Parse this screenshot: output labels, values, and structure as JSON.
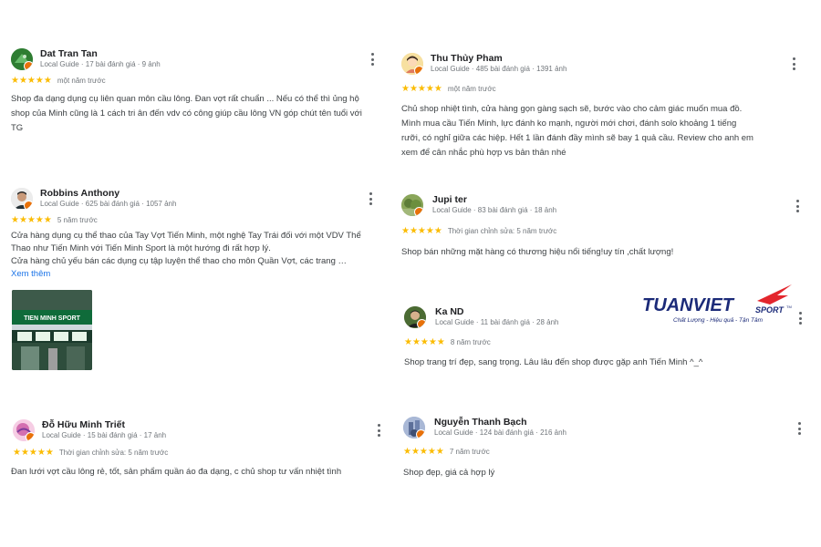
{
  "reviews": [
    {
      "name": "Dat Tran Tan",
      "meta": "Local Guide · 17 bài đánh giá · 9 ảnh",
      "stars": "★★★★★",
      "time": "một năm trước",
      "lines": [
        "Shop đa dạng dụng cụ liên quan môn cầu lông. Đan vợt rất chuẩn ... Nếu có thể thì ủng hộ",
        "shop của Minh cũng là 1 cách tri ân đến vdv có công giúp cầu lông VN góp chút tên tuổi với",
        "TG"
      ]
    },
    {
      "name": "Thu Thủy Pham",
      "meta": "Local Guide · 485 bài đánh giá · 1391 ảnh",
      "stars": "★★★★★",
      "time": "một năm trước",
      "lines": [
        "Chủ shop nhiệt tình, cửa hàng gọn gàng sạch sẽ, bước vào cho cảm giác muốn mua đồ.",
        "Mình mua cầu Tiến Minh, lực đánh ko mạnh, người mới chơi, đánh solo khoảng 1 tiếng",
        "rưỡi, có nghỉ giữa các hiệp. Hết 1 lần đánh đầy mình sẽ bay 1 quả cầu. Review cho anh em",
        "xem để cân nhắc phù hợp vs bản thân nhé"
      ]
    },
    {
      "name": "Robbins Anthony",
      "meta": "Local Guide · 625 bài đánh giá · 1057 ảnh",
      "stars": "★★★★★",
      "time": "5 năm trước",
      "lines": [
        "Cửa hàng dụng cụ thể thao của Tay Vợt Tiến Minh, một nghệ Tay Trái đối với một VDV Thể",
        "Thao như Tiến Minh với Tiến Minh Sport là một hướng đi rất hợp lý.",
        "Cửa hàng chủ yếu bán các dụng cụ tập luyện thể thao cho môn Quần Vợt, các trang …"
      ],
      "see_more": "Xem thêm",
      "photo_sign": "TIEN MINH SPORT"
    },
    {
      "name": "Jupi ter",
      "meta": "Local Guide · 83 bài đánh giá · 18 ảnh",
      "stars": "★★★★★",
      "time": "Thời gian chỉnh sửa: 5 năm trước",
      "lines": [
        "Shop bán những mặt hàng có thương hiệu nổi tiếng!uy tín ,chất lượng!"
      ]
    },
    {
      "name": "Ka ND",
      "meta": "Local Guide · 11 bài đánh giá · 28 ảnh",
      "stars": "★★★★★",
      "time": "8 năm trước",
      "lines": [
        "Shop trang trí đẹp, sang trọng. Lâu lâu đến shop được gặp anh Tiến Minh ^_^"
      ]
    },
    {
      "name": "Đỗ Hữu Minh Triết",
      "meta": "Local Guide · 15 bài đánh giá · 17 ảnh",
      "stars": "★★★★★",
      "time": "Thời gian chỉnh sửa: 5 năm trước",
      "lines": [
        "Đan lưới vợt cầu lông rẻ, tốt, sản phẩm quần áo đa dạng, c chủ shop tư vấn nhiệt tình"
      ]
    },
    {
      "name": "Nguyễn Thanh Bạch",
      "meta": "Local Guide · 124 bài đánh giá · 216 ảnh",
      "stars": "★★★★★",
      "time": "7 năm trước",
      "lines": [
        "Shop đẹp, giá cả hợp lý"
      ]
    }
  ],
  "logo": {
    "brand": "TUANVIET",
    "sport": "SPORT",
    "tm": "TM",
    "tagline": "Chất Lượng - Hiệu quả - Tận Tâm",
    "colors": {
      "navy": "#1b2a78",
      "red": "#e3262d"
    }
  },
  "colors": {
    "star": "#fbbc04",
    "link": "#1a73e8",
    "meta": "#70757a",
    "badge": "#e8710a"
  },
  "icons": {
    "more": "more-vert-icon",
    "badge": "local-guide-badge-icon"
  }
}
